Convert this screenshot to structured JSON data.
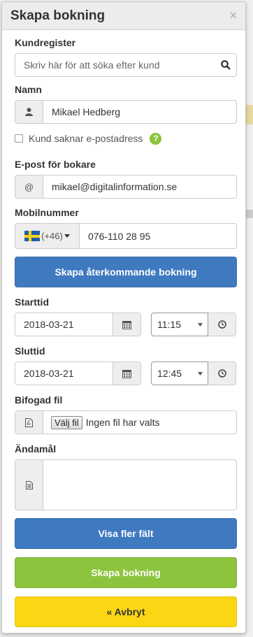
{
  "modal": {
    "title": "Skapa bokning",
    "close_symbol": "×"
  },
  "customer_register": {
    "label": "Kundregister",
    "placeholder": "Skriv här för att söka efter kund",
    "icon": "search-icon"
  },
  "name": {
    "label": "Namn",
    "value": "Mikael Hedberg",
    "icon": "user-icon"
  },
  "no_email": {
    "label": "Kund saknar e-postadress",
    "checked": false,
    "help_symbol": "?"
  },
  "email": {
    "label": "E-post för bokare",
    "prefix": "@",
    "value": "mikael@digitalinformation.se"
  },
  "mobile": {
    "label": "Mobilnummer",
    "country_code": "(+46)",
    "value": "076-110 28 95"
  },
  "recurring_button": "Skapa återkommande bokning",
  "start": {
    "label": "Starttid",
    "date": "2018-03-21",
    "time": "11:15"
  },
  "end": {
    "label": "Sluttid",
    "date": "2018-03-21",
    "time": "12:45"
  },
  "attachment": {
    "label": "Bifogad fil",
    "choose_button": "Välj fil",
    "status": "Ingen fil har valts"
  },
  "purpose": {
    "label": "Ändamål",
    "value": ""
  },
  "buttons": {
    "more_fields": "Visa fler fält",
    "create": "Skapa bokning",
    "cancel": "« Avbryt"
  },
  "colors": {
    "primary_blue": "#3f7ac0",
    "success_green": "#8cc43d",
    "warning_yellow": "#fbd614",
    "header_bg": "#ececec"
  }
}
